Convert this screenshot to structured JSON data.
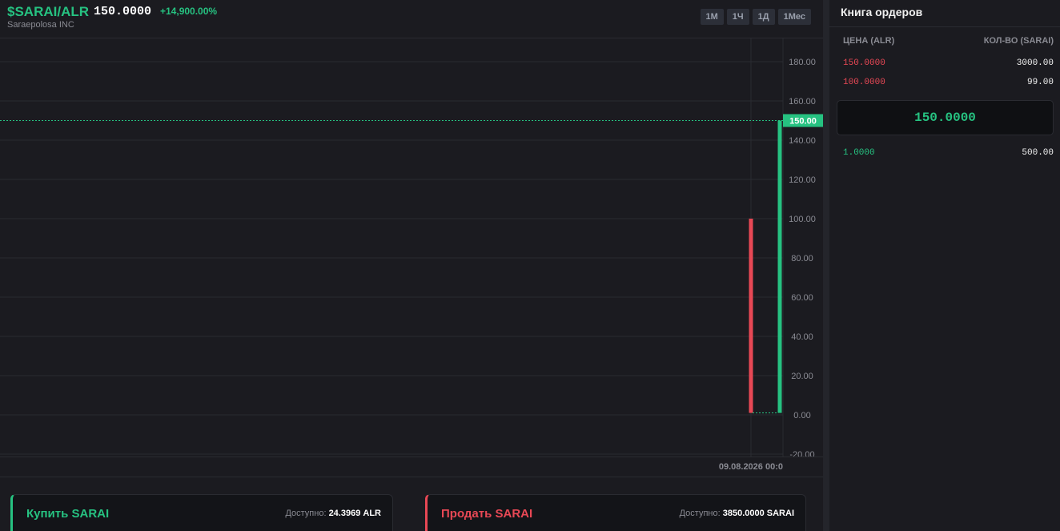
{
  "header": {
    "pair": "$SARAI/ALR",
    "price": "150.0000",
    "change": "+14,900.00%",
    "company": "Saraepolosa INC",
    "timeframes": [
      "1М",
      "1Ч",
      "1Д",
      "1Мес"
    ]
  },
  "colors": {
    "up": "#26c281",
    "down": "#e84855",
    "background": "#1b1b20"
  },
  "chart_data": {
    "type": "candlestick",
    "y_ticks": [
      "180.00",
      "160.00",
      "140.00",
      "120.00",
      "100.00",
      "80.00",
      "60.00",
      "40.00",
      "20.00",
      "0.00",
      "-20.00"
    ],
    "ylim": [
      -20,
      190
    ],
    "candles": [
      {
        "open": 100,
        "high": 100,
        "low": 1,
        "close": 1,
        "direction": "down"
      },
      {
        "open": 1,
        "high": 150,
        "low": 1,
        "close": 150,
        "direction": "up"
      }
    ],
    "last_price_label": "150.00",
    "last_price": 150,
    "time_label": "09.08.2026 00:0"
  },
  "trade": {
    "buy": {
      "title": "Купить SARAI",
      "avail_label": "Доступно:",
      "avail_value": "24.3969 ALR"
    },
    "sell": {
      "title": "Продать SARAI",
      "avail_label": "Доступно:",
      "avail_value": "3850.0000 SARAI"
    }
  },
  "orderbook": {
    "title": "Книга ордеров",
    "col_price": "ЦЕНА (ALR)",
    "col_qty": "КОЛ-ВО (SARAI)",
    "asks": [
      {
        "price": "150.0000",
        "qty": "3000.00"
      },
      {
        "price": "100.0000",
        "qty": "99.00"
      }
    ],
    "mid": "150.0000",
    "bids": [
      {
        "price": "1.0000",
        "qty": "500.00"
      }
    ]
  }
}
